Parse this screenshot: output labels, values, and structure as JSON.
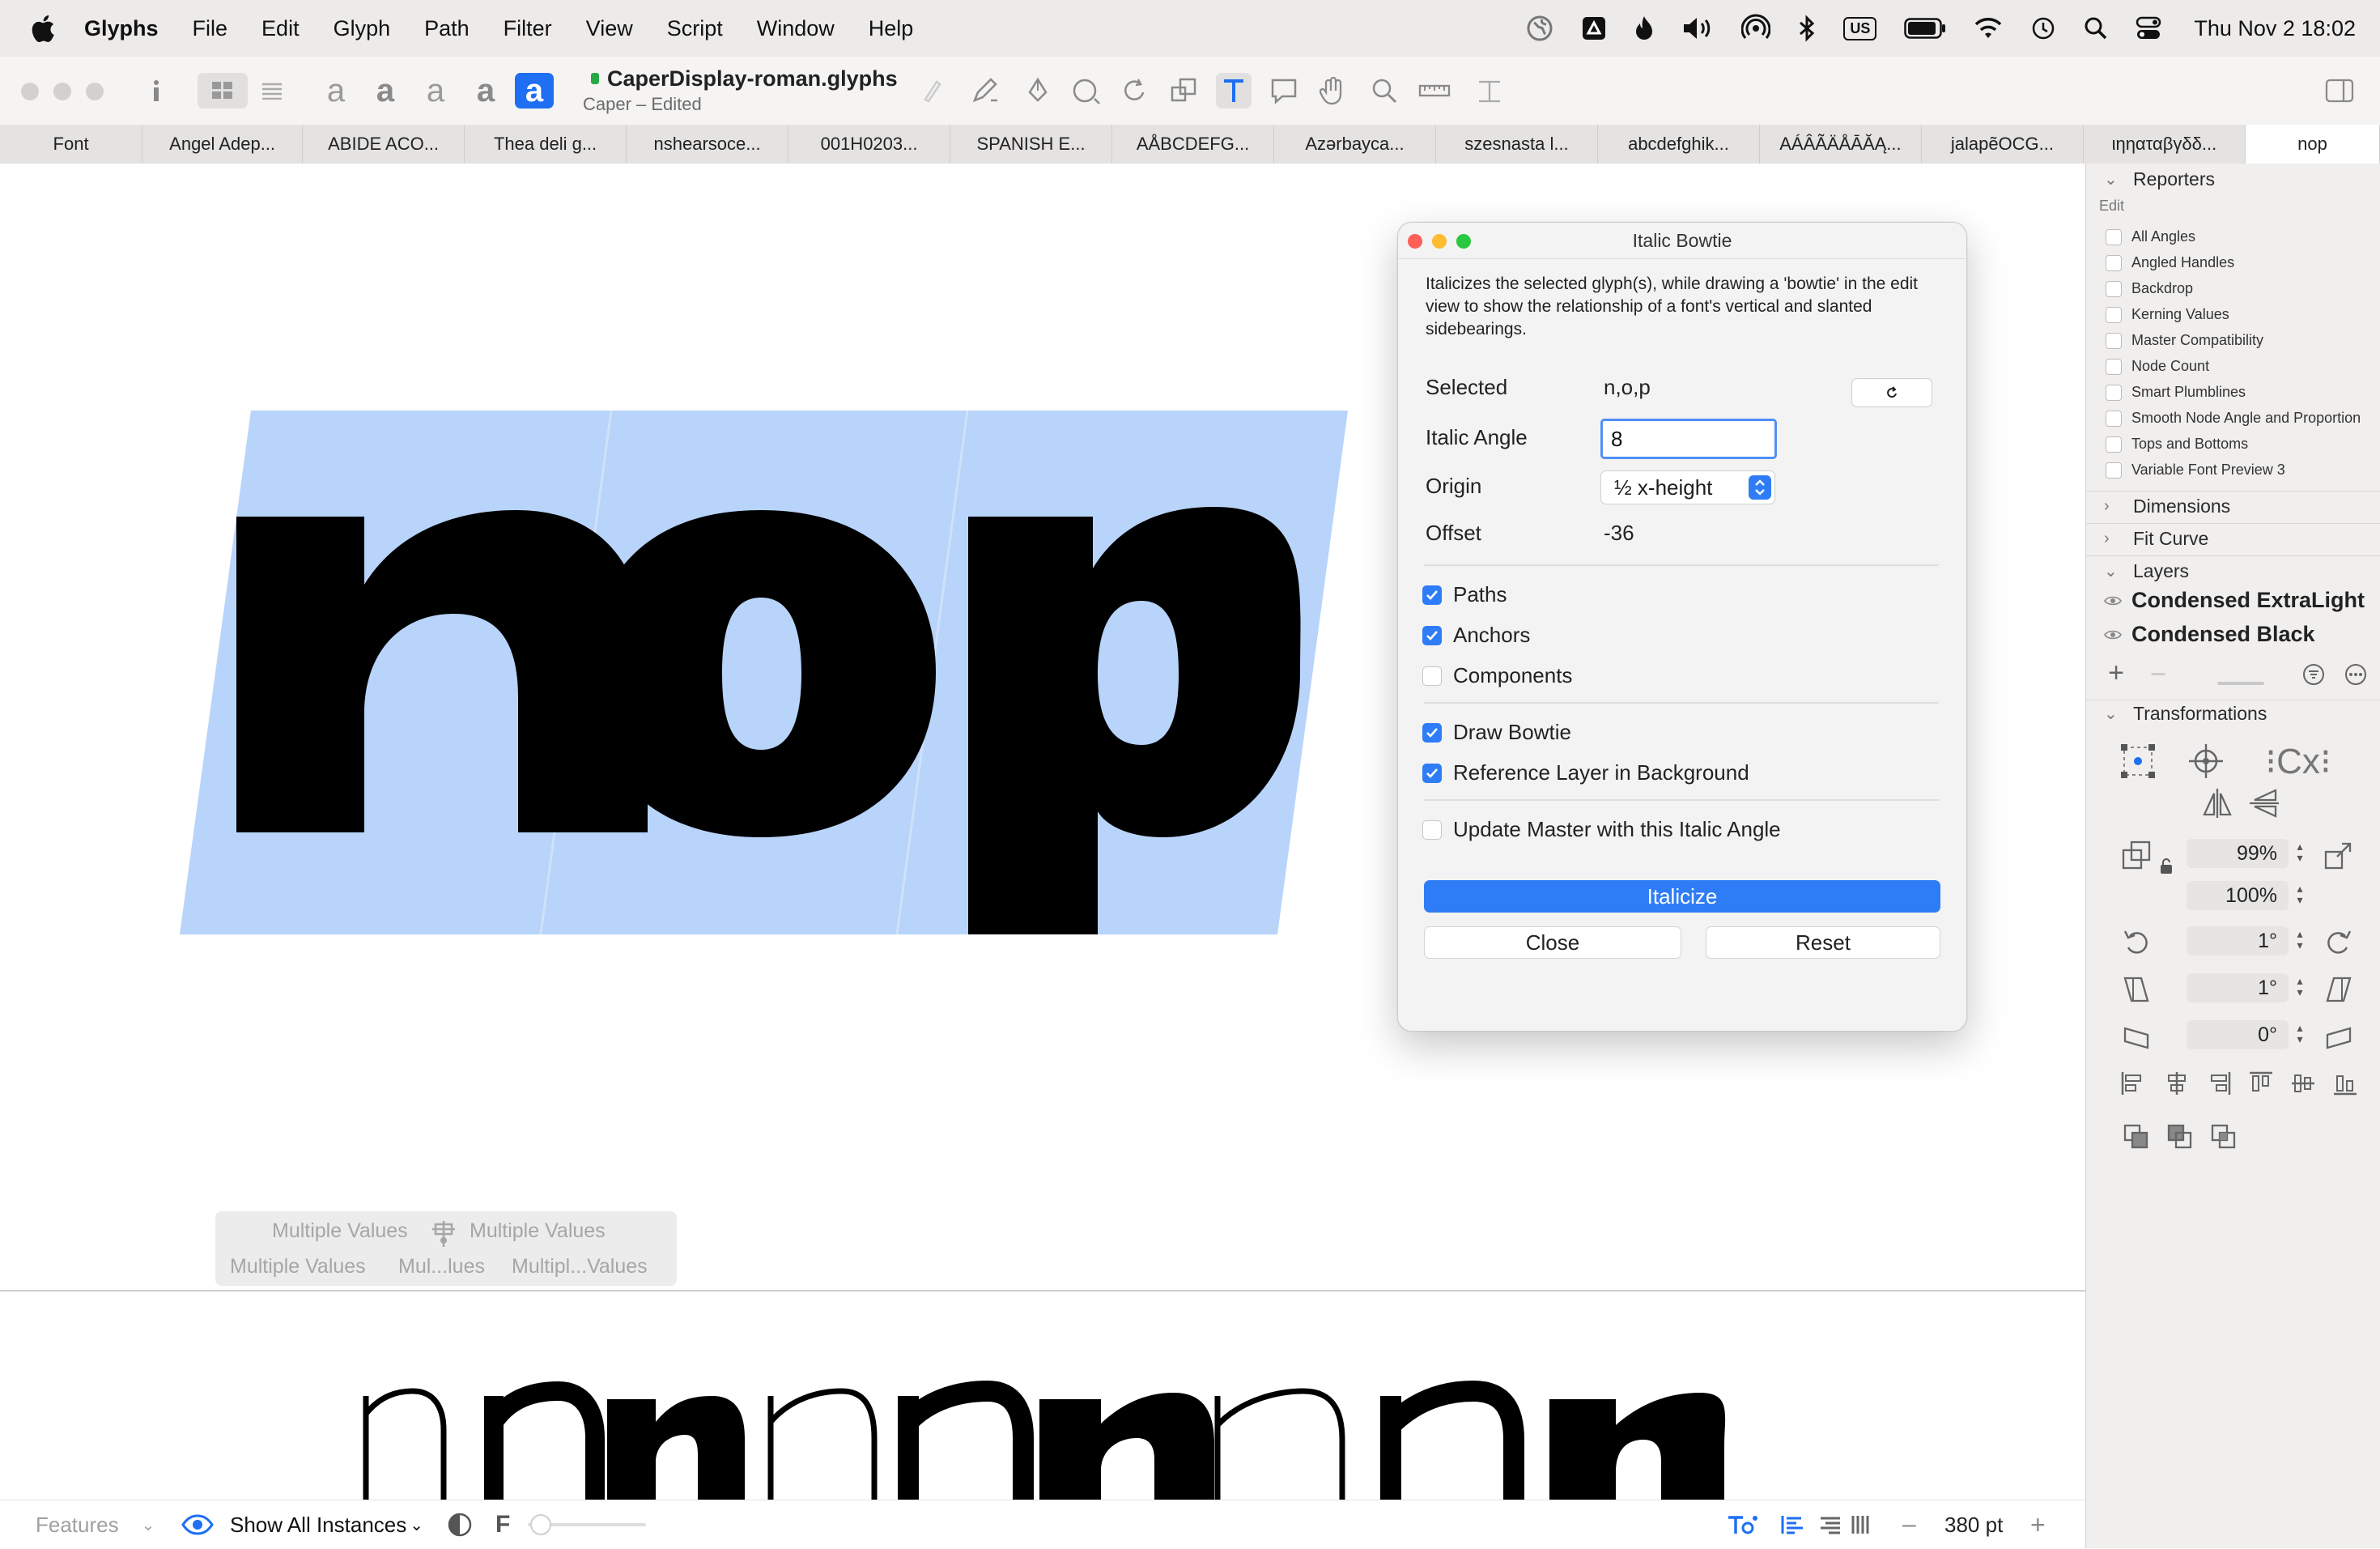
{
  "menubar": {
    "app_name": "Glyphs",
    "items": [
      "File",
      "Edit",
      "Glyph",
      "Path",
      "Filter",
      "View",
      "Script",
      "Window",
      "Help"
    ],
    "keyboard_layout": "US",
    "clock": "Thu Nov 2  18:02"
  },
  "document": {
    "filename": "CaperDisplay-roman.glyphs",
    "subtitle": "Caper – Edited"
  },
  "tabs": [
    {
      "label": "Font"
    },
    {
      "label": "Angel Adep..."
    },
    {
      "label": "ABIDE ACO..."
    },
    {
      "label": "Thea deli g..."
    },
    {
      "label": "nshearsoce..."
    },
    {
      "label": "001H0203..."
    },
    {
      "label": "SPANISH E..."
    },
    {
      "label": "AÅBCDEFG..."
    },
    {
      "label": "Azərbayca..."
    },
    {
      "label": "szesnasta l..."
    },
    {
      "label": "abcdefghik..."
    },
    {
      "label": "AÁÂÃÄÅĀĂĄ..."
    },
    {
      "label": "jalapẽOCG..."
    },
    {
      "label": "ιηηαταβγδδ..."
    },
    {
      "label": "nop"
    }
  ],
  "canvas": {
    "edit_text": "nop",
    "preview_text": "nnnnnnnnnn",
    "multiple_values": {
      "top_left": "Multiple Values",
      "top_right": "Multiple Values",
      "bottom_left": "Multiple Values",
      "bottom_mid": "Mul...lues",
      "bottom_right": "Multipl...Values"
    }
  },
  "bottom_bar": {
    "features_label": "Features",
    "instances_label": "Show All Instances",
    "f_label": "F",
    "size_value": "380 pt"
  },
  "sidebar": {
    "reporters": {
      "title": "Reporters",
      "subtitle": "Edit",
      "items": [
        {
          "label": "All Angles",
          "checked": false
        },
        {
          "label": "Angled Handles",
          "checked": false
        },
        {
          "label": "Backdrop",
          "checked": false
        },
        {
          "label": "Kerning Values",
          "checked": false
        },
        {
          "label": "Master Compatibility",
          "checked": false
        },
        {
          "label": "Node Count",
          "checked": false
        },
        {
          "label": "Smart Plumblines",
          "checked": false
        },
        {
          "label": "Smooth Node Angle and Proportion",
          "checked": false
        },
        {
          "label": "Tops and Bottoms",
          "checked": false
        },
        {
          "label": "Variable Font Preview 3",
          "checked": false
        }
      ]
    },
    "dimensions_label": "Dimensions",
    "fit_curve_label": "Fit Curve",
    "layers": {
      "title": "Layers",
      "items": [
        "Condensed ExtraLight",
        "Condensed Black"
      ]
    },
    "transformations": {
      "title": "Transformations",
      "scale_x": "99%",
      "scale_y": "100%",
      "rotate": "1°",
      "slant": "1°",
      "skew": "0°"
    }
  },
  "panel": {
    "title": "Italic Bowtie",
    "description": "Italicizes the selected glyph(s), while drawing a 'bowtie' in the edit view to show the relationship of a font's vertical and slanted sidebearings.",
    "selected_label": "Selected",
    "selected_value": "n,o,p",
    "italic_angle_label": "Italic Angle",
    "italic_angle_value": "8",
    "origin_label": "Origin",
    "origin_value": "½ x-height",
    "offset_label": "Offset",
    "offset_value": "-36",
    "checks": [
      {
        "label": "Paths",
        "checked": true
      },
      {
        "label": "Anchors",
        "checked": true
      },
      {
        "label": "Components",
        "checked": false
      },
      {
        "label": "Draw Bowtie",
        "checked": true
      },
      {
        "label": "Reference Layer in Background",
        "checked": true
      },
      {
        "label": "Update Master with this Italic Angle",
        "checked": false
      }
    ],
    "italicize_label": "Italicize",
    "close_label": "Close",
    "reset_label": "Reset"
  },
  "colors": {
    "accent": "#2f7df6",
    "bowtie_fill": "#b8d4fa",
    "glyph_fill": "#000000"
  }
}
